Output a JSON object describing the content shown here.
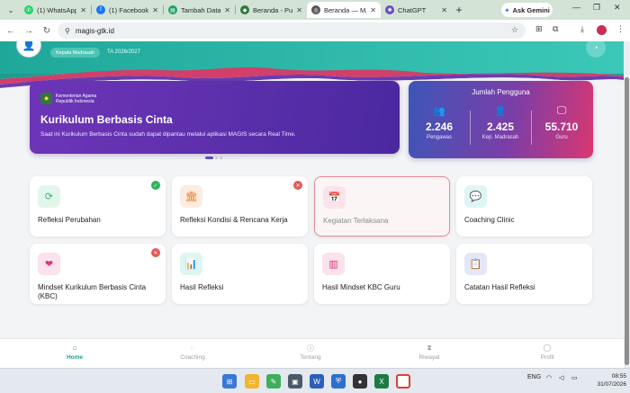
{
  "browser": {
    "tabs": [
      {
        "title": "(1) WhatsApp",
        "color": "#25d366",
        "glyph": "✆"
      },
      {
        "title": "(1) Facebook",
        "color": "#1877f2",
        "glyph": "f"
      },
      {
        "title": "Tambah Data Ta",
        "color": "#1aa260",
        "glyph": "▤"
      },
      {
        "title": "Beranda - Pusat",
        "color": "#2d7a3a",
        "glyph": "◆"
      },
      {
        "title": "Beranda — MA",
        "color": "#555555",
        "glyph": "◎"
      },
      {
        "title": "ChatGPT",
        "color": "#6a4bc4",
        "glyph": "✺"
      }
    ],
    "active_tab_index": 4,
    "new_tab": "+",
    "gemini_label": "Ask Gemini",
    "url": "magis-gtk.id"
  },
  "header": {
    "role": "Kepala Madrasah",
    "year": "TA 2026/2027"
  },
  "banner": {
    "ministry_line1": "Kementerian Agama",
    "ministry_line2": "Republik Indonesia",
    "title": "Kurikulum Berbasis Cinta",
    "description": "Saat ini Kurikulum Berbasis Cinta sudah dapat dipantau melalui aplikasi MAGIS secara Real Time."
  },
  "stats": {
    "title": "Jumlah Pengguna",
    "items": [
      {
        "icon": "users-icon",
        "value": "2.246",
        "label": "Pengawas"
      },
      {
        "icon": "user-icon",
        "value": "2.425",
        "label": "Kep. Madrasah"
      },
      {
        "icon": "teacher-icon",
        "value": "55.710",
        "label": "Guru"
      }
    ]
  },
  "menu": [
    {
      "label": "Refleksi Perubahan",
      "icon": "refresh-icon",
      "icon_color": "#2db87a",
      "icon_bg": "#e3f6ec",
      "badge": "check"
    },
    {
      "label": "Refleksi Kondisi & Rencana Kerja",
      "icon": "institution-icon",
      "icon_color": "#e07b2c",
      "icon_bg": "#fdece0",
      "badge": "cross"
    },
    {
      "label": "Kegiatan Terlaksana",
      "icon": "calendar-check-icon",
      "icon_color": "#e06d95",
      "icon_bg": "#fbe3ec",
      "badge": "",
      "disabled": true
    },
    {
      "label": "Coaching Clinic",
      "icon": "chat-icon",
      "icon_color": "#1fb0a8",
      "icon_bg": "#def5f3",
      "badge": ""
    },
    {
      "label": "Mindset Kurikulum Berbasis Cinta (KBC)",
      "icon": "heart-icon",
      "icon_color": "#e03579",
      "icon_bg": "#fbe2ec",
      "badge": "cross"
    },
    {
      "label": "Hasil Refleksi",
      "icon": "bar-chart-icon",
      "icon_color": "#1fb0a8",
      "icon_bg": "#def5f3",
      "badge": ""
    },
    {
      "label": "Hasil Mindset KBC Guru",
      "icon": "chart-square-icon",
      "icon_color": "#d9336f",
      "icon_bg": "#fbe2ec",
      "badge": ""
    },
    {
      "label": "Catatan Hasil Refleksi",
      "icon": "clipboard-icon",
      "icon_color": "#3f4fb8",
      "icon_bg": "#e3e7f8",
      "badge": ""
    }
  ],
  "bottom_nav": [
    {
      "label": "Home",
      "icon": "home-icon",
      "active": true
    },
    {
      "label": "Coaching",
      "icon": "chat-icon",
      "active": false
    },
    {
      "label": "Tentang",
      "icon": "info-icon",
      "active": false
    },
    {
      "label": "Riwayat",
      "icon": "history-icon",
      "active": false
    },
    {
      "label": "Profil",
      "icon": "user-icon",
      "active": false
    }
  ],
  "taskbar": {
    "language": "ENG",
    "time": "08:55",
    "date": "31/07/2026"
  }
}
